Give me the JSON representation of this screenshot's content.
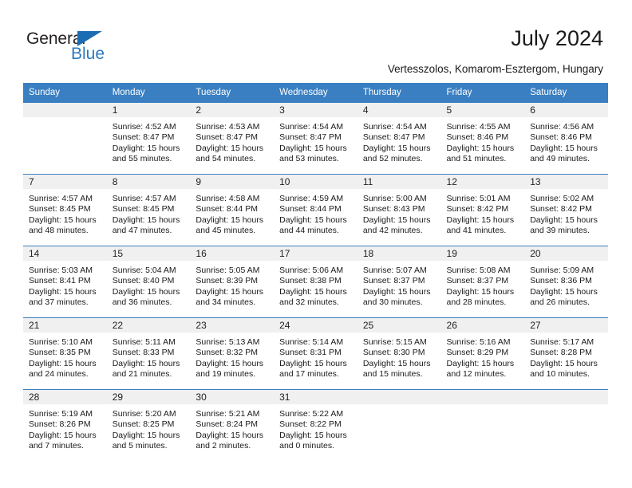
{
  "brand": {
    "name_dark": "General",
    "name_blue": "Blue",
    "accent_color": "#2e79bf",
    "triangle_color": "#1b6cb3"
  },
  "header": {
    "title": "July 2024",
    "subtitle": "Vertesszolos, Komarom-Esztergom, Hungary"
  },
  "calendar": {
    "header_bg": "#3a7fc1",
    "daynum_bg": "#f0f0f0",
    "weekday_headers": [
      "Sunday",
      "Monday",
      "Tuesday",
      "Wednesday",
      "Thursday",
      "Friday",
      "Saturday"
    ],
    "labels": {
      "sunrise": "Sunrise:",
      "sunset": "Sunset:",
      "daylight": "Daylight:"
    },
    "weeks": [
      [
        {
          "day": "",
          "empty": true,
          "sunrise": "",
          "sunset": "",
          "daylight_line1": "",
          "daylight_line2": ""
        },
        {
          "day": "1",
          "sunrise": "Sunrise: 4:52 AM",
          "sunset": "Sunset: 8:47 PM",
          "daylight_line1": "Daylight: 15 hours",
          "daylight_line2": "and 55 minutes."
        },
        {
          "day": "2",
          "sunrise": "Sunrise: 4:53 AM",
          "sunset": "Sunset: 8:47 PM",
          "daylight_line1": "Daylight: 15 hours",
          "daylight_line2": "and 54 minutes."
        },
        {
          "day": "3",
          "sunrise": "Sunrise: 4:54 AM",
          "sunset": "Sunset: 8:47 PM",
          "daylight_line1": "Daylight: 15 hours",
          "daylight_line2": "and 53 minutes."
        },
        {
          "day": "4",
          "sunrise": "Sunrise: 4:54 AM",
          "sunset": "Sunset: 8:47 PM",
          "daylight_line1": "Daylight: 15 hours",
          "daylight_line2": "and 52 minutes."
        },
        {
          "day": "5",
          "sunrise": "Sunrise: 4:55 AM",
          "sunset": "Sunset: 8:46 PM",
          "daylight_line1": "Daylight: 15 hours",
          "daylight_line2": "and 51 minutes."
        },
        {
          "day": "6",
          "sunrise": "Sunrise: 4:56 AM",
          "sunset": "Sunset: 8:46 PM",
          "daylight_line1": "Daylight: 15 hours",
          "daylight_line2": "and 49 minutes."
        }
      ],
      [
        {
          "day": "7",
          "sunrise": "Sunrise: 4:57 AM",
          "sunset": "Sunset: 8:45 PM",
          "daylight_line1": "Daylight: 15 hours",
          "daylight_line2": "and 48 minutes."
        },
        {
          "day": "8",
          "sunrise": "Sunrise: 4:57 AM",
          "sunset": "Sunset: 8:45 PM",
          "daylight_line1": "Daylight: 15 hours",
          "daylight_line2": "and 47 minutes."
        },
        {
          "day": "9",
          "sunrise": "Sunrise: 4:58 AM",
          "sunset": "Sunset: 8:44 PM",
          "daylight_line1": "Daylight: 15 hours",
          "daylight_line2": "and 45 minutes."
        },
        {
          "day": "10",
          "sunrise": "Sunrise: 4:59 AM",
          "sunset": "Sunset: 8:44 PM",
          "daylight_line1": "Daylight: 15 hours",
          "daylight_line2": "and 44 minutes."
        },
        {
          "day": "11",
          "sunrise": "Sunrise: 5:00 AM",
          "sunset": "Sunset: 8:43 PM",
          "daylight_line1": "Daylight: 15 hours",
          "daylight_line2": "and 42 minutes."
        },
        {
          "day": "12",
          "sunrise": "Sunrise: 5:01 AM",
          "sunset": "Sunset: 8:42 PM",
          "daylight_line1": "Daylight: 15 hours",
          "daylight_line2": "and 41 minutes."
        },
        {
          "day": "13",
          "sunrise": "Sunrise: 5:02 AM",
          "sunset": "Sunset: 8:42 PM",
          "daylight_line1": "Daylight: 15 hours",
          "daylight_line2": "and 39 minutes."
        }
      ],
      [
        {
          "day": "14",
          "sunrise": "Sunrise: 5:03 AM",
          "sunset": "Sunset: 8:41 PM",
          "daylight_line1": "Daylight: 15 hours",
          "daylight_line2": "and 37 minutes."
        },
        {
          "day": "15",
          "sunrise": "Sunrise: 5:04 AM",
          "sunset": "Sunset: 8:40 PM",
          "daylight_line1": "Daylight: 15 hours",
          "daylight_line2": "and 36 minutes."
        },
        {
          "day": "16",
          "sunrise": "Sunrise: 5:05 AM",
          "sunset": "Sunset: 8:39 PM",
          "daylight_line1": "Daylight: 15 hours",
          "daylight_line2": "and 34 minutes."
        },
        {
          "day": "17",
          "sunrise": "Sunrise: 5:06 AM",
          "sunset": "Sunset: 8:38 PM",
          "daylight_line1": "Daylight: 15 hours",
          "daylight_line2": "and 32 minutes."
        },
        {
          "day": "18",
          "sunrise": "Sunrise: 5:07 AM",
          "sunset": "Sunset: 8:37 PM",
          "daylight_line1": "Daylight: 15 hours",
          "daylight_line2": "and 30 minutes."
        },
        {
          "day": "19",
          "sunrise": "Sunrise: 5:08 AM",
          "sunset": "Sunset: 8:37 PM",
          "daylight_line1": "Daylight: 15 hours",
          "daylight_line2": "and 28 minutes."
        },
        {
          "day": "20",
          "sunrise": "Sunrise: 5:09 AM",
          "sunset": "Sunset: 8:36 PM",
          "daylight_line1": "Daylight: 15 hours",
          "daylight_line2": "and 26 minutes."
        }
      ],
      [
        {
          "day": "21",
          "sunrise": "Sunrise: 5:10 AM",
          "sunset": "Sunset: 8:35 PM",
          "daylight_line1": "Daylight: 15 hours",
          "daylight_line2": "and 24 minutes."
        },
        {
          "day": "22",
          "sunrise": "Sunrise: 5:11 AM",
          "sunset": "Sunset: 8:33 PM",
          "daylight_line1": "Daylight: 15 hours",
          "daylight_line2": "and 21 minutes."
        },
        {
          "day": "23",
          "sunrise": "Sunrise: 5:13 AM",
          "sunset": "Sunset: 8:32 PM",
          "daylight_line1": "Daylight: 15 hours",
          "daylight_line2": "and 19 minutes."
        },
        {
          "day": "24",
          "sunrise": "Sunrise: 5:14 AM",
          "sunset": "Sunset: 8:31 PM",
          "daylight_line1": "Daylight: 15 hours",
          "daylight_line2": "and 17 minutes."
        },
        {
          "day": "25",
          "sunrise": "Sunrise: 5:15 AM",
          "sunset": "Sunset: 8:30 PM",
          "daylight_line1": "Daylight: 15 hours",
          "daylight_line2": "and 15 minutes."
        },
        {
          "day": "26",
          "sunrise": "Sunrise: 5:16 AM",
          "sunset": "Sunset: 8:29 PM",
          "daylight_line1": "Daylight: 15 hours",
          "daylight_line2": "and 12 minutes."
        },
        {
          "day": "27",
          "sunrise": "Sunrise: 5:17 AM",
          "sunset": "Sunset: 8:28 PM",
          "daylight_line1": "Daylight: 15 hours",
          "daylight_line2": "and 10 minutes."
        }
      ],
      [
        {
          "day": "28",
          "sunrise": "Sunrise: 5:19 AM",
          "sunset": "Sunset: 8:26 PM",
          "daylight_line1": "Daylight: 15 hours",
          "daylight_line2": "and 7 minutes."
        },
        {
          "day": "29",
          "sunrise": "Sunrise: 5:20 AM",
          "sunset": "Sunset: 8:25 PM",
          "daylight_line1": "Daylight: 15 hours",
          "daylight_line2": "and 5 minutes."
        },
        {
          "day": "30",
          "sunrise": "Sunrise: 5:21 AM",
          "sunset": "Sunset: 8:24 PM",
          "daylight_line1": "Daylight: 15 hours",
          "daylight_line2": "and 2 minutes."
        },
        {
          "day": "31",
          "sunrise": "Sunrise: 5:22 AM",
          "sunset": "Sunset: 8:22 PM",
          "daylight_line1": "Daylight: 15 hours",
          "daylight_line2": "and 0 minutes."
        },
        {
          "day": "",
          "empty": true,
          "sunrise": "",
          "sunset": "",
          "daylight_line1": "",
          "daylight_line2": ""
        },
        {
          "day": "",
          "empty": true,
          "sunrise": "",
          "sunset": "",
          "daylight_line1": "",
          "daylight_line2": ""
        },
        {
          "day": "",
          "empty": true,
          "sunrise": "",
          "sunset": "",
          "daylight_line1": "",
          "daylight_line2": ""
        }
      ]
    ]
  }
}
